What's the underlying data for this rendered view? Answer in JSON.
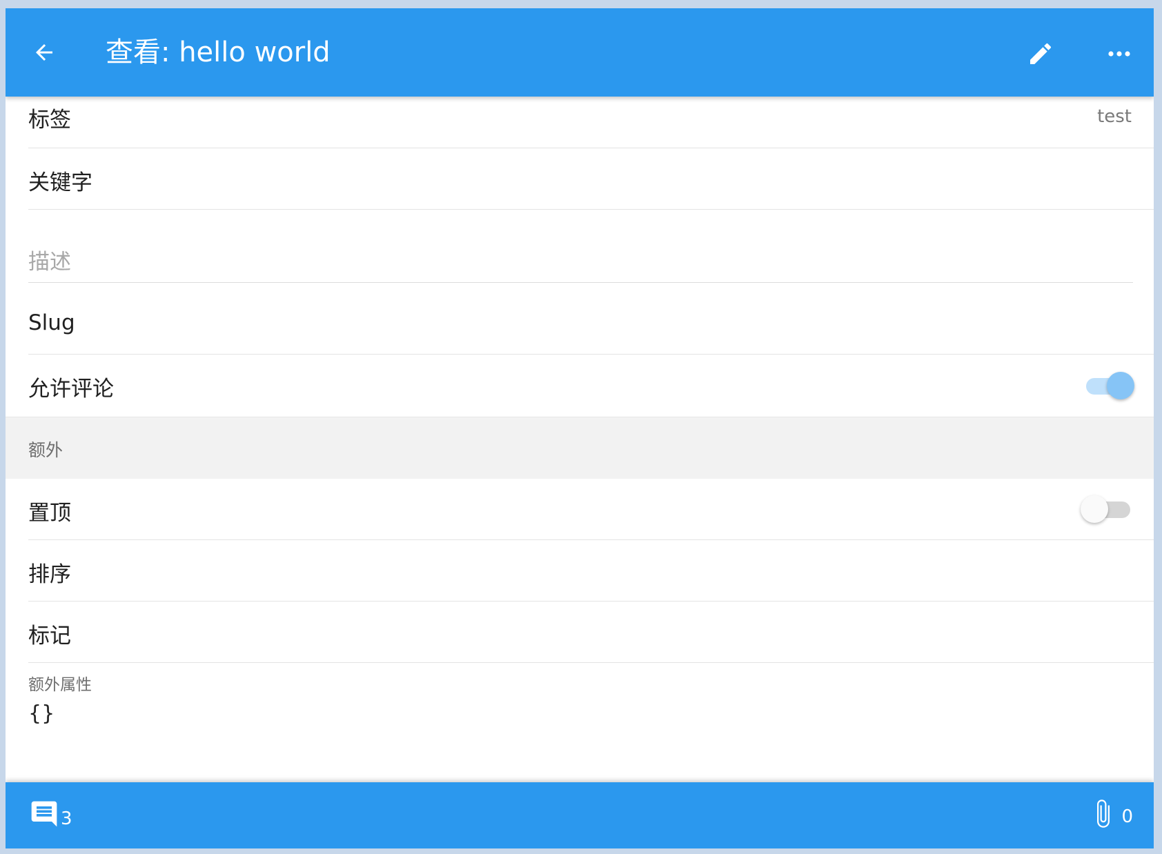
{
  "appbar": {
    "title": "查看: hello world",
    "back_icon": "arrow-left-icon",
    "edit_icon": "pencil-icon",
    "more_icon": "more-horizontal-icon"
  },
  "fields": {
    "tags": {
      "label": "标签",
      "value": "test"
    },
    "keywords": {
      "label": "关键字",
      "value": ""
    },
    "description": {
      "placeholder": "描述"
    },
    "slug": {
      "label": "Slug",
      "value": ""
    },
    "allow_comments": {
      "label": "允许评论",
      "enabled": true
    }
  },
  "extra_section": {
    "header": "额外",
    "sticky": {
      "label": "置顶",
      "enabled": false
    },
    "order": {
      "label": "排序",
      "value": ""
    },
    "mark": {
      "label": "标记",
      "value": ""
    },
    "extra_props": {
      "label": "额外属性",
      "value": "{}"
    }
  },
  "bottombar": {
    "comment_icon": "comment-icon",
    "comment_count": "3",
    "attachment_icon": "paperclip-icon",
    "attachment_count": "0"
  },
  "colors": {
    "primary": "#2b98ee",
    "toggle_on": "#86c4f6",
    "section_bg": "#f2f2f2"
  }
}
